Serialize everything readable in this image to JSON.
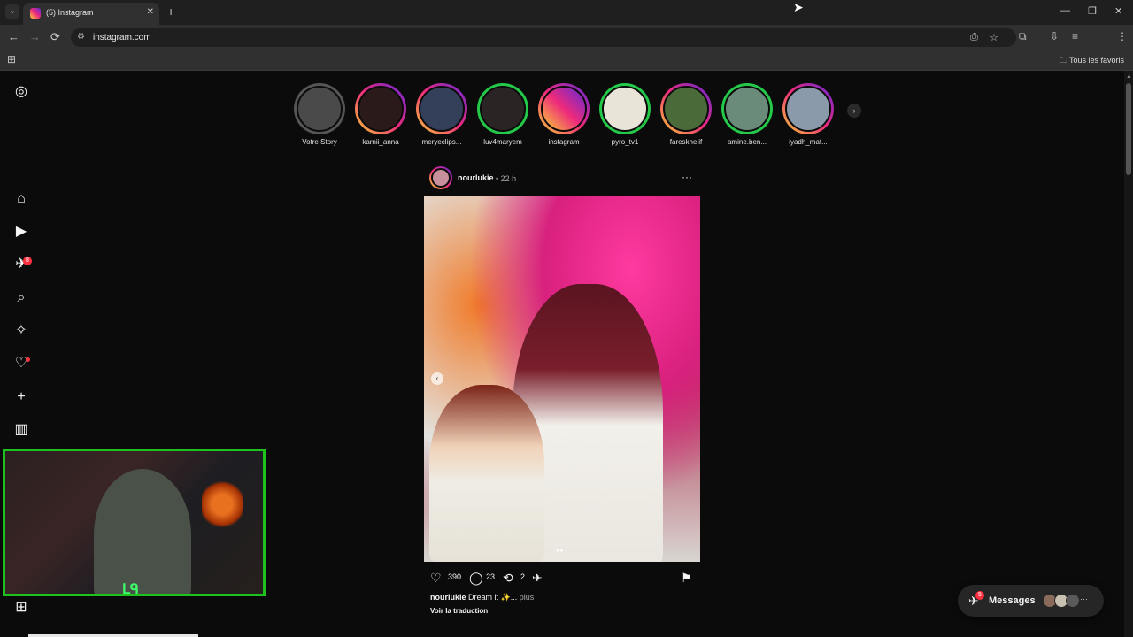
{
  "browser": {
    "tab_title": "(5) Instagram",
    "url": "instagram.com",
    "bookmarks_folder": "Tous les favoris",
    "tab_menu_glyph": "⌄",
    "new_tab_glyph": "+",
    "close_glyph": "✕",
    "minimize_glyph": "—",
    "restore_glyph": "❐",
    "back_glyph": "←",
    "forward_glyph": "→",
    "reload_glyph": "⟳",
    "site_info_glyph": "⚙",
    "apps_glyph": "⊞",
    "folder_glyph": "🗀"
  },
  "sidebar": {
    "items": [
      {
        "name": "instagram-icon",
        "glyph": "◎"
      },
      {
        "name": "home-icon",
        "glyph": "⌂"
      },
      {
        "name": "reels-icon",
        "glyph": "▶"
      },
      {
        "name": "messages-icon",
        "glyph": "✈",
        "badge": "8"
      },
      {
        "name": "search-icon",
        "glyph": "⌕"
      },
      {
        "name": "explore-icon",
        "glyph": "✧"
      },
      {
        "name": "notifications-icon",
        "glyph": "♡"
      },
      {
        "name": "create-icon",
        "glyph": "+"
      },
      {
        "name": "dashboard-icon",
        "glyph": "▥"
      },
      {
        "name": "more-icon",
        "glyph": "⊞"
      }
    ]
  },
  "stories": [
    {
      "name": "Votre Story",
      "ring": "seen",
      "color": "#4a4a4a"
    },
    {
      "name": "karnii_anna",
      "ring": "gradient",
      "color": "#2a1a1a"
    },
    {
      "name": "meryeclips...",
      "ring": "gradient",
      "color": "#34405a"
    },
    {
      "name": "luv4maryem",
      "ring": "green",
      "color": "#2a2424"
    },
    {
      "name": "instagram",
      "ring": "gradient",
      "color": "#e1306c"
    },
    {
      "name": "pyro_tv1",
      "ring": "green",
      "color": "#e8e4d8"
    },
    {
      "name": "fareskhelif",
      "ring": "gradient",
      "color": "#4a6a3a"
    },
    {
      "name": "amine.ben...",
      "ring": "green",
      "color": "#6a8a7a"
    },
    {
      "name": "iyadh_mat...",
      "ring": "gradient",
      "color": "#8a9aaa"
    }
  ],
  "post": {
    "username": "nourlukie",
    "time": "• 22 h",
    "more_glyph": "···",
    "prev_glyph": "‹",
    "carousel_dots": "●●",
    "likes": "390",
    "comments": "23",
    "reposts": "2",
    "caption_user": "nourlukie",
    "caption_text": "Dream it ✨...",
    "caption_more": "plus",
    "translate": "Voir la traduction"
  },
  "messages": {
    "label": "Messages",
    "badge": "5"
  },
  "colors": {
    "accent_red": "#ff3040",
    "webcam_border": "#1ec21e"
  }
}
